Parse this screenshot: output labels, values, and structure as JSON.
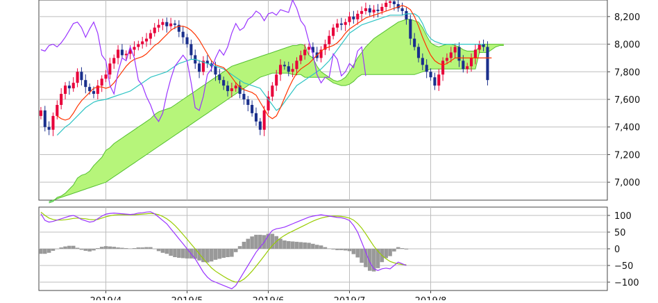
{
  "chart_data": [
    {
      "type": "candlestick",
      "panel": "price",
      "y_ticks": [
        "8,200",
        "8,000",
        "7,800",
        "7,600",
        "7,400",
        "7,200",
        "7,000"
      ],
      "y_tick_values": [
        8200,
        8000,
        7800,
        7600,
        7400,
        7200,
        7000
      ],
      "ylim": [
        6870,
        8320
      ],
      "x_labels": [
        "2019/4",
        "2019/5",
        "2019/6",
        "2019/7",
        "2019/8"
      ],
      "x_label_index": [
        16,
        36,
        56,
        76,
        96
      ],
      "x_count": 140,
      "grid": true,
      "colors": {
        "up": "#e8003a",
        "down": "#1a2f8c",
        "tenkan": "#ff3300",
        "kijun": "#2ec4c4",
        "chikou": "#9933ff",
        "cloud_bull": "#b6f57a",
        "cloud_bear": "#8ff0c8",
        "cloud_edge": "#55c030"
      },
      "series": [
        {
          "key": "close",
          "values": [
            7520,
            7400,
            7380,
            7480,
            7560,
            7640,
            7700,
            7680,
            7720,
            7800,
            7740,
            7690,
            7660,
            7640,
            7700,
            7750,
            7780,
            7860,
            7900,
            7960,
            7920,
            7930,
            7960,
            7980,
            8000,
            8020,
            8040,
            8080,
            8120,
            8140,
            8160,
            8130,
            8150,
            8140,
            8090,
            8050,
            8000,
            7920,
            7860,
            7800,
            7880,
            7860,
            7840,
            7780,
            7740,
            7700,
            7660,
            7680,
            7700,
            7640,
            7600,
            7560,
            7500,
            7440,
            7380,
            7520,
            7620,
            7700,
            7780,
            7850,
            7840,
            7800,
            7820,
            7880,
            7920,
            7960,
            7980,
            7940,
            7900,
            7960,
            8000,
            8060,
            8120,
            8150,
            8140,
            8160,
            8200,
            8180,
            8220,
            8240,
            8260,
            8230,
            8250,
            8240,
            8270,
            8300,
            8310,
            8290,
            8260,
            8240,
            8180,
            8040,
            7980,
            7900,
            7850,
            7800,
            7760,
            7700,
            7780,
            7880,
            7900,
            7940,
            7980,
            7880,
            7820,
            7840,
            7900,
            7960,
            8000,
            7980,
            7740
          ]
        },
        {
          "key": "tenkan",
          "values": [
            7480,
            7460,
            7450,
            7460,
            7500,
            7550,
            7590,
            7620,
            7650,
            7680,
            7690,
            7690,
            7680,
            7690,
            7720,
            7760,
            7800,
            7840,
            7870,
            7890,
            7900,
            7910,
            7930,
            7960,
            7990,
            8010,
            8040,
            8070,
            8100,
            8120,
            8130,
            8130,
            8120,
            8100,
            8070,
            8030,
            7980,
            7930,
            7880,
            7850,
            7840,
            7830,
            7800,
            7760,
            7720,
            7690,
            7670,
            7660,
            7650,
            7630,
            7580,
            7530,
            7480,
            7460,
            7480,
            7540,
            7610,
            7680,
            7740,
            7790,
            7820,
            7840,
            7860,
            7890,
            7920,
            7950,
            7970,
            7980,
            7990,
            8010,
            8040,
            8080,
            8110,
            8130,
            8150,
            8170,
            8190,
            8200,
            8210,
            8220,
            8230,
            8240,
            8250,
            8260,
            8270,
            8280,
            8270,
            8250,
            8200,
            8130,
            8050,
            7980,
            7920,
            7880,
            7860,
            7850,
            7860,
            7880,
            7900,
            7900,
            7900,
            7900,
            7900,
            7900,
            7900,
            7900,
            7900,
            7900
          ]
        },
        {
          "key": "kijun",
          "values": [
            7340,
            7370,
            7400,
            7420,
            7450,
            7480,
            7510,
            7540,
            7560,
            7580,
            7590,
            7595,
            7600,
            7610,
            7620,
            7630,
            7640,
            7650,
            7660,
            7680,
            7700,
            7720,
            7740,
            7760,
            7770,
            7780,
            7790,
            7800,
            7820,
            7840,
            7860,
            7870,
            7880,
            7890,
            7890,
            7880,
            7870,
            7860,
            7850,
            7840,
            7830,
            7820,
            7800,
            7780,
            7760,
            7740,
            7720,
            7710,
            7700,
            7690,
            7680,
            7640,
            7600,
            7560,
            7520,
            7540,
            7580,
            7620,
            7660,
            7700,
            7720,
            7740,
            7760,
            7780,
            7800,
            7820,
            7850,
            7880,
            7920,
            7960,
            8000,
            8040,
            8080,
            8100,
            8120,
            8140,
            8150,
            8160,
            8170,
            8180,
            8190,
            8200,
            8210,
            8210,
            8210,
            8210,
            8220,
            8220,
            8220,
            8200,
            8150,
            8080,
            8040,
            8020,
            8010,
            8000,
            8000,
            8000,
            8000,
            8000,
            8000,
            8000,
            8000,
            8000,
            8000,
            8000
          ]
        },
        {
          "key": "chikou",
          "values": [
            7960,
            7950,
            7990,
            8000,
            7980,
            8010,
            8050,
            8100,
            8150,
            8160,
            8120,
            8050,
            8110,
            8160,
            8080,
            7920,
            7880,
            7700,
            7640,
            7800,
            7900,
            7880,
            7980,
            7900,
            7740,
            7700,
            7620,
            7560,
            7480,
            7440,
            7500,
            7640,
            7750,
            7840,
            7880,
            7920,
            7880,
            7720,
            7540,
            7520,
            7620,
            7780,
            7820,
            7900,
            7960,
            7920,
            7980,
            8080,
            8150,
            8100,
            8120,
            8180,
            8200,
            8240,
            8220,
            8170,
            8220,
            8230,
            8210,
            8250,
            8240,
            8230,
            8320,
            8260,
            8170,
            8130,
            8020,
            7930,
            7780,
            7720,
            7760,
            7760,
            7930,
            7890,
            7770,
            7800,
            7860,
            7830,
            7950,
            7980,
            7770
          ]
        },
        {
          "key": "senkou_a",
          "values": [
            6850,
            6860,
            6890,
            6900,
            6920,
            6950,
            6980,
            7030,
            7050,
            7060,
            7080,
            7120,
            7150,
            7180,
            7230,
            7250,
            7280,
            7300,
            7320,
            7340,
            7360,
            7380,
            7400,
            7420,
            7440,
            7460,
            7490,
            7510,
            7520,
            7530,
            7540,
            7560,
            7580,
            7600,
            7620,
            7640,
            7660,
            7680,
            7700,
            7720,
            7740,
            7760,
            7780,
            7800,
            7820,
            7840,
            7850,
            7860,
            7870,
            7880,
            7890,
            7900,
            7910,
            7920,
            7930,
            7940,
            7950,
            7960,
            7970,
            7980,
            7990,
            7990,
            8000,
            7990,
            7920,
            7900,
            7840,
            7800,
            7780,
            7760,
            7740,
            7730,
            7740,
            7760,
            7800,
            7850,
            7900,
            7940,
            7980,
            8010,
            8040,
            8060,
            8080,
            8100,
            8120,
            8140,
            8160,
            8170,
            8180,
            8180,
            8170,
            8160,
            8120,
            8060,
            8010,
            7990,
            7980,
            7990,
            8000,
            8000,
            7990,
            7980,
            7960,
            7950,
            7950,
            7950,
            7980,
            8000,
            8000,
            8000,
            8000,
            8000,
            8000
          ]
        },
        {
          "key": "senkou_b",
          "values": [
            6860,
            6870,
            6880,
            6890,
            6900,
            6910,
            6920,
            6930,
            6940,
            6950,
            6960,
            6970,
            6980,
            6990,
            7000,
            7020,
            7040,
            7060,
            7080,
            7100,
            7120,
            7140,
            7160,
            7180,
            7200,
            7220,
            7240,
            7260,
            7280,
            7300,
            7320,
            7340,
            7360,
            7380,
            7400,
            7420,
            7440,
            7460,
            7480,
            7500,
            7520,
            7540,
            7560,
            7580,
            7600,
            7620,
            7640,
            7660,
            7680,
            7700,
            7720,
            7740,
            7760,
            7770,
            7780,
            7790,
            7790,
            7790,
            7790,
            7790,
            7780,
            7780,
            7780,
            7760,
            7760,
            7760,
            7760,
            7760,
            7760,
            7740,
            7720,
            7710,
            7700,
            7700,
            7710,
            7730,
            7760,
            7780,
            7780,
            7780,
            7780,
            7780,
            7780,
            7780,
            7780,
            7780,
            7780,
            7780,
            7780,
            7780,
            7780,
            7790,
            7800,
            7810,
            7820,
            7820,
            7820,
            7820,
            7820,
            7820,
            7820,
            7820,
            7820,
            7820,
            7820,
            7820,
            7940,
            7940,
            7940,
            7960,
            7980,
            7990,
            7990
          ]
        }
      ]
    },
    {
      "type": "line+histogram",
      "panel": "oscillator",
      "y_ticks": [
        "100",
        "50",
        "0",
        "−50",
        "−100"
      ],
      "y_tick_values": [
        100,
        50,
        0,
        -50,
        -100
      ],
      "ylim": [
        -125,
        125
      ],
      "x_labels": [
        "2019/4",
        "2019/5",
        "2019/6",
        "2019/7",
        "2019/8"
      ],
      "x_label_index": [
        16,
        36,
        56,
        76,
        96
      ],
      "x_count": 140,
      "grid": true,
      "colors": {
        "line1": "#9933ff",
        "line2": "#99cc00",
        "bars": "#999999"
      },
      "series": [
        {
          "key": "line1",
          "values": [
            105,
            85,
            80,
            82,
            86,
            90,
            94,
            98,
            100,
            95,
            88,
            84,
            80,
            82,
            90,
            98,
            104,
            106,
            107,
            106,
            105,
            104,
            103,
            104,
            107,
            108,
            110,
            111,
            105,
            95,
            85,
            75,
            60,
            45,
            30,
            15,
            0,
            -15,
            -30,
            -50,
            -70,
            -85,
            -95,
            -100,
            -105,
            -110,
            -115,
            -120,
            -110,
            -90,
            -70,
            -50,
            -30,
            -10,
            5,
            20,
            40,
            55,
            60,
            62,
            65,
            70,
            75,
            80,
            85,
            90,
            95,
            98,
            100,
            102,
            100,
            98,
            96,
            94,
            93,
            90,
            85,
            70,
            50,
            20,
            -10,
            -40,
            -60,
            -65,
            -60,
            -58,
            -60,
            -50,
            -40,
            -45,
            -50
          ]
        },
        {
          "key": "line2",
          "values": [
            110,
            100,
            92,
            88,
            86,
            86,
            87,
            89,
            91,
            92,
            91,
            90,
            88,
            87,
            88,
            92,
            96,
            99,
            101,
            102,
            102,
            102,
            102,
            102,
            103,
            104,
            105,
            106,
            105,
            102,
            97,
            90,
            81,
            70,
            57,
            43,
            29,
            14,
            0,
            -15,
            -30,
            -44,
            -57,
            -67,
            -75,
            -83,
            -90,
            -96,
            -100,
            -98,
            -91,
            -80,
            -67,
            -52,
            -37,
            -21,
            -5,
            10,
            22,
            32,
            40,
            47,
            53,
            59,
            65,
            71,
            77,
            83,
            88,
            92,
            95,
            97,
            98,
            98,
            97,
            95,
            92,
            86,
            76,
            62,
            45,
            26,
            8,
            -7,
            -20,
            -30,
            -38,
            -42,
            -45,
            -47,
            -48
          ]
        },
        {
          "key": "bars",
          "values": [
            -15,
            -15,
            -12,
            -6,
            0,
            4,
            7,
            9,
            9,
            3,
            -3,
            -6,
            -8,
            -5,
            2,
            6,
            8,
            7,
            6,
            4,
            3,
            2,
            1,
            2,
            4,
            4,
            5,
            5,
            0,
            -7,
            -12,
            -15,
            -21,
            -25,
            -27,
            -28,
            -29,
            -29,
            -30,
            -35,
            -40,
            -41,
            -38,
            -33,
            -30,
            -27,
            -25,
            -24,
            -10,
            8,
            21,
            30,
            37,
            42,
            42,
            41,
            45,
            45,
            38,
            30,
            25,
            23,
            22,
            21,
            20,
            19,
            18,
            15,
            12,
            10,
            5,
            1,
            -2,
            -4,
            -4,
            -5,
            -7,
            -16,
            -26,
            -42,
            -55,
            -66,
            -68,
            -58,
            -40,
            -28,
            -22,
            -8,
            5,
            2,
            -2
          ]
        }
      ]
    }
  ]
}
